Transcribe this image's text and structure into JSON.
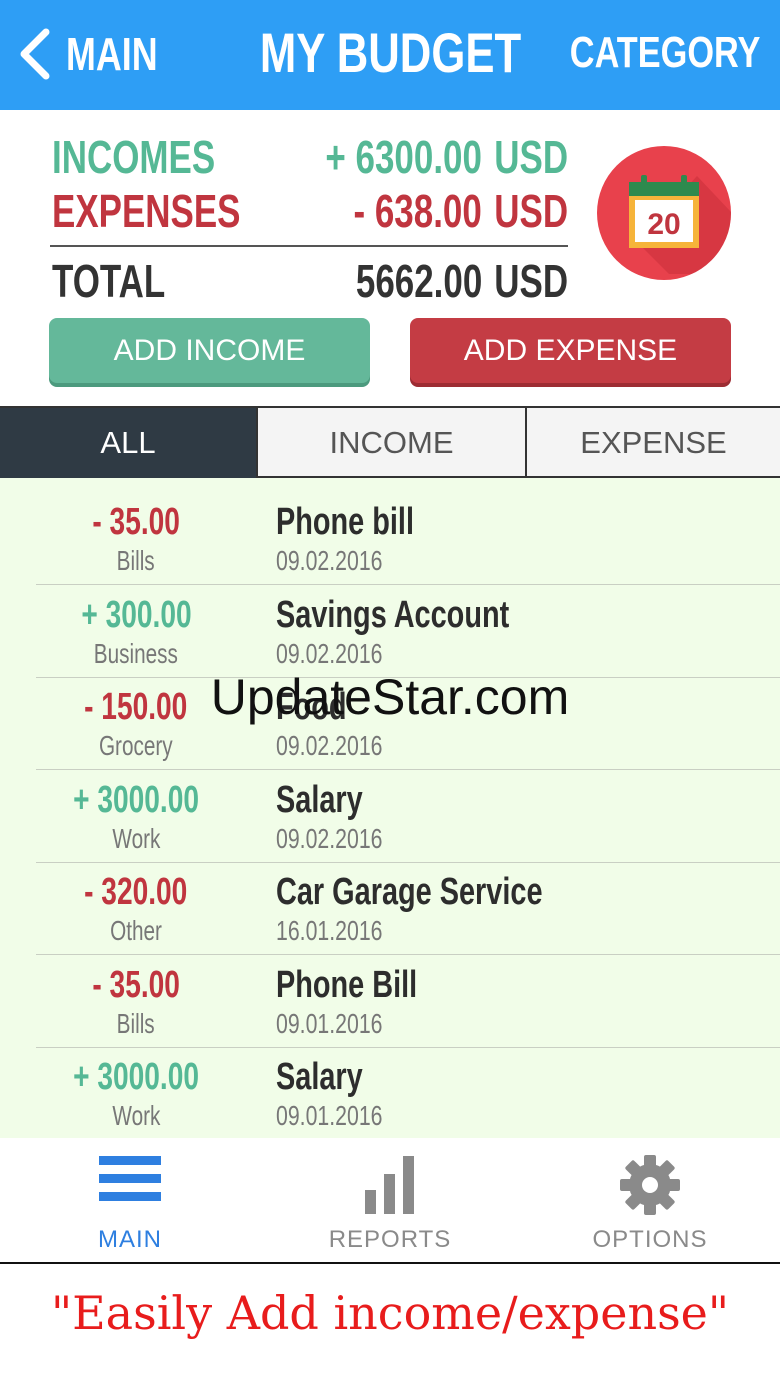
{
  "header": {
    "back_label": "MAIN",
    "title": "MY BUDGET",
    "category_label": "CATEGORY"
  },
  "summary": {
    "incomes_label": "INCOMES",
    "incomes_amount": "+ 6300.00",
    "expenses_label": "EXPENSES",
    "expenses_amount": "- 638.00",
    "total_label": "TOTAL",
    "total_amount": "5662.00",
    "currency": "USD",
    "calendar_day": "20",
    "add_income_label": "ADD INCOME",
    "add_expense_label": "ADD EXPENSE"
  },
  "tabs": [
    {
      "label": "ALL",
      "active": true
    },
    {
      "label": "INCOME",
      "active": false
    },
    {
      "label": "EXPENSE",
      "active": false
    }
  ],
  "transactions": [
    {
      "amount": "- 35.00",
      "type": "expense",
      "category": "Bills",
      "name": "Phone bill",
      "date": "09.02.2016"
    },
    {
      "amount": "+ 300.00",
      "type": "income",
      "category": "Business",
      "name": "Savings Account",
      "date": "09.02.2016"
    },
    {
      "amount": "- 150.00",
      "type": "expense",
      "category": "Grocery",
      "name": "Food",
      "date": "09.02.2016"
    },
    {
      "amount": "+ 3000.00",
      "type": "income",
      "category": "Work",
      "name": "Salary",
      "date": "09.02.2016"
    },
    {
      "amount": "- 320.00",
      "type": "expense",
      "category": "Other",
      "name": "Car Garage Service",
      "date": "16.01.2016"
    },
    {
      "amount": "- 35.00",
      "type": "expense",
      "category": "Bills",
      "name": "Phone Bill",
      "date": "09.01.2016"
    },
    {
      "amount": "+ 3000.00",
      "type": "income",
      "category": "Work",
      "name": "Salary",
      "date": "09.01.2016"
    }
  ],
  "watermark": "UpdateStar.com",
  "nav": {
    "main_label": "MAIN",
    "reports_label": "REPORTS",
    "options_label": "OPTIONS"
  },
  "caption": "\"Easily Add income/expense\"",
  "colors": {
    "header_blue": "#2e9ef5",
    "income_green": "#55b895",
    "expense_red": "#c0353f",
    "tab_active": "#2f3a44",
    "list_bg": "#f1fde8",
    "nav_active": "#2e7fe0",
    "caption_red": "#e81c1c"
  },
  "icons": {
    "back": "chevron-left-icon",
    "calendar": "calendar-icon",
    "main": "menu-icon",
    "reports": "bar-chart-icon",
    "options": "gear-icon"
  }
}
